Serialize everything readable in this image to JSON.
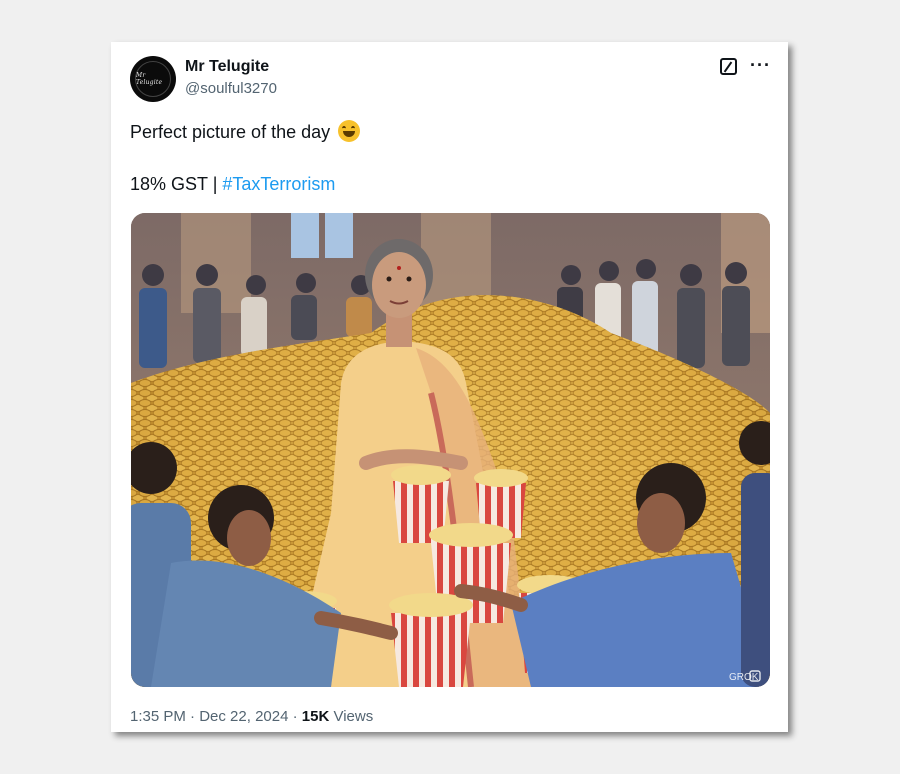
{
  "author": {
    "name": "Mr Telugite",
    "handle": "@soulful3270",
    "avatar_text": "Mr Telugite"
  },
  "post": {
    "line1": "Perfect picture of the day",
    "line2_prefix": "18% GST | ",
    "hashtag": "#TaxTerrorism"
  },
  "image": {
    "watermark": "GROK"
  },
  "meta": {
    "time": "1:35 PM",
    "separator1": " · ",
    "date": "Dec 22, 2024",
    "separator2": " · ",
    "views_count": "15K",
    "views_label": " Views"
  },
  "icons": {
    "grok": "grok-icon",
    "more": "more-icon",
    "emoji": "grinning-face-icon"
  },
  "colors": {
    "link": "#1d9bf0",
    "text": "#0f1419",
    "muted": "#536471"
  }
}
